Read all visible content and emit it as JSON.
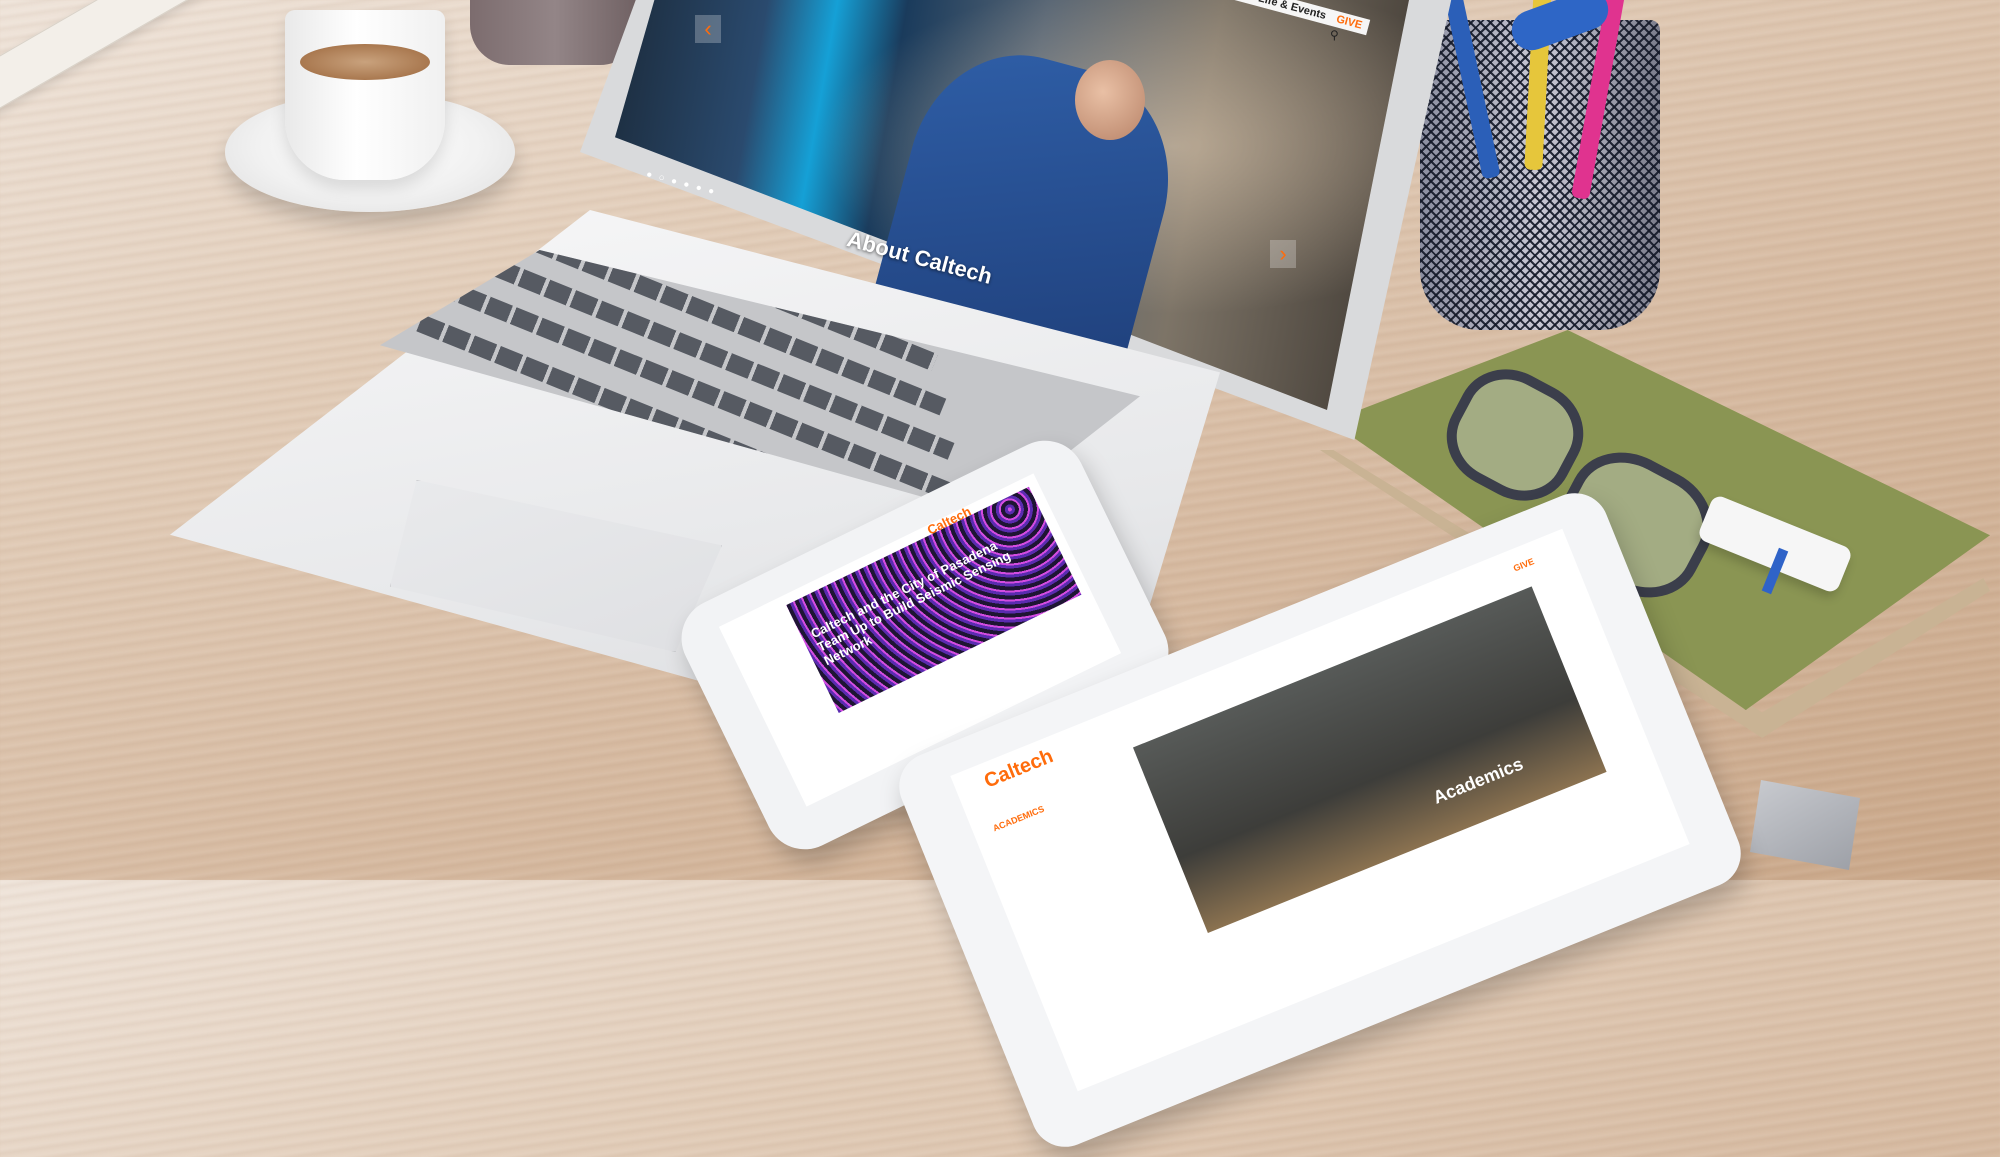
{
  "laptop_screen": {
    "nav_text": "Campus Life & Events",
    "give_label": "GIVE",
    "hero_title": "About Caltech",
    "prev_arrow": "‹",
    "next_arrow": "›",
    "slider_dots": "● ○ ● ● ● ●"
  },
  "phone_screen": {
    "logo": "Caltech",
    "headline": "Caltech and the City of Pasadena Team Up to Build Seismic Sensing Network"
  },
  "tablet_screen": {
    "logo": "Caltech",
    "hero_title": "Academics",
    "section_label": "ACADEMICS",
    "give_label": "GIVE"
  },
  "colors": {
    "accent": "#ff6c0c",
    "book_cover": "#8a9553",
    "usb_band": "#2f63c8"
  },
  "icons": [
    "search-icon",
    "chevron-left-icon",
    "chevron-right-icon"
  ]
}
